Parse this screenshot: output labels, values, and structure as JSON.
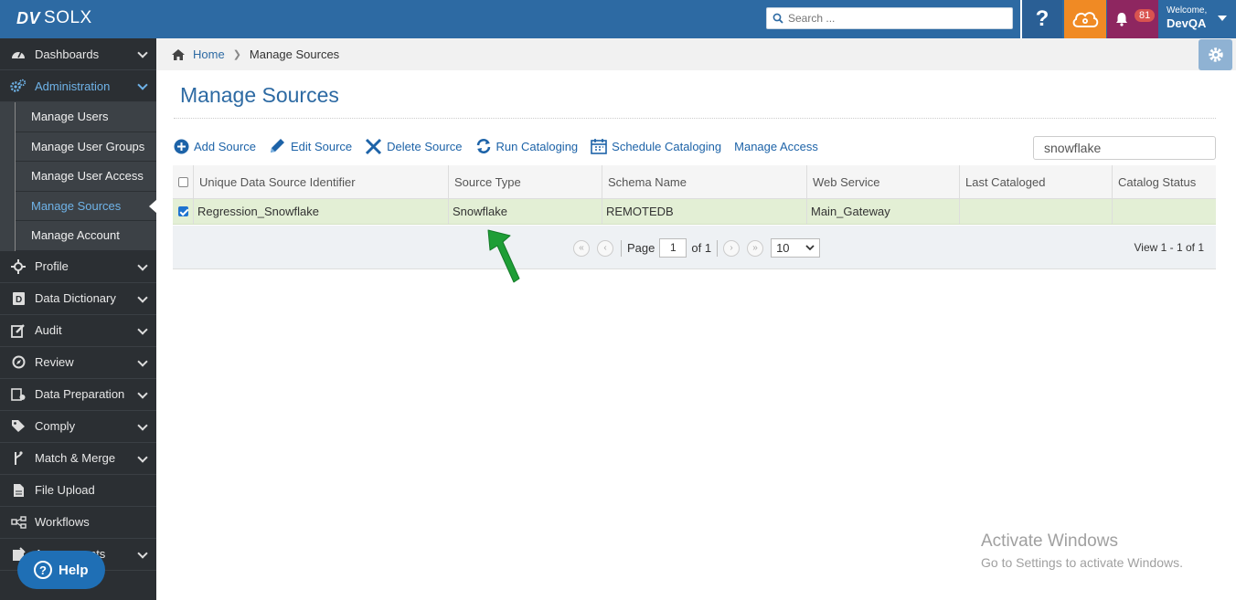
{
  "app": {
    "logo_dv": "DV",
    "logo_name": "SOLX"
  },
  "topbar": {
    "search_placeholder": "Search ...",
    "help_label": "?",
    "notifications_count": "81",
    "welcome": "Welcome,",
    "user": "DevQA"
  },
  "sidebar": {
    "items": [
      {
        "label": "Dashboards",
        "icon": "dashboard-icon"
      },
      {
        "label": "Administration",
        "icon": "gears-icon"
      },
      {
        "label": "Profile",
        "icon": "profile-icon"
      },
      {
        "label": "Data Dictionary",
        "icon": "dictionary-icon"
      },
      {
        "label": "Audit",
        "icon": "audit-icon"
      },
      {
        "label": "Review",
        "icon": "review-icon"
      },
      {
        "label": "Data Preparation",
        "icon": "data-prep-icon"
      },
      {
        "label": "Comply",
        "icon": "tag-icon"
      },
      {
        "label": "Match & Merge",
        "icon": "merge-icon"
      },
      {
        "label": "File Upload",
        "icon": "file-icon"
      },
      {
        "label": "Workflows",
        "icon": "workflow-icon"
      },
      {
        "label": "Assessments",
        "icon": "assessment-icon"
      }
    ],
    "admin_sub": [
      "Manage Users",
      "Manage User Groups",
      "Manage User Access",
      "Manage Sources",
      "Manage Account"
    ]
  },
  "breadcrumb": {
    "home": "Home",
    "current": "Manage Sources"
  },
  "page": {
    "title": "Manage Sources"
  },
  "toolbar": {
    "add": "Add Source",
    "edit": "Edit Source",
    "delete": "Delete Source",
    "run": "Run Cataloging",
    "schedule": "Schedule Cataloging",
    "access": "Manage Access",
    "filter_value": "snowflake"
  },
  "grid": {
    "columns": [
      "Unique Data Source Identifier",
      "Source Type",
      "Schema Name",
      "Web Service",
      "Last Cataloged",
      "Catalog Status"
    ],
    "rows": [
      {
        "id": "Regression_Snowflake",
        "type": "Snowflake",
        "schema": "REMOTEDB",
        "service": "Main_Gateway",
        "last": "",
        "status": ""
      }
    ]
  },
  "pager": {
    "page_label": "Page",
    "page": "1",
    "of_label": "of 1",
    "rows": "10",
    "view": "View 1 - 1 of 1"
  },
  "watermark": {
    "line1": "Activate Windows",
    "line2": "Go to Settings to activate Windows."
  },
  "help": {
    "label": "Help"
  },
  "colors": {
    "primary": "#2d6aa3",
    "sidebar": "#2b2f33",
    "row_selected": "#e3efd5",
    "arrow": "#1e9e36"
  }
}
